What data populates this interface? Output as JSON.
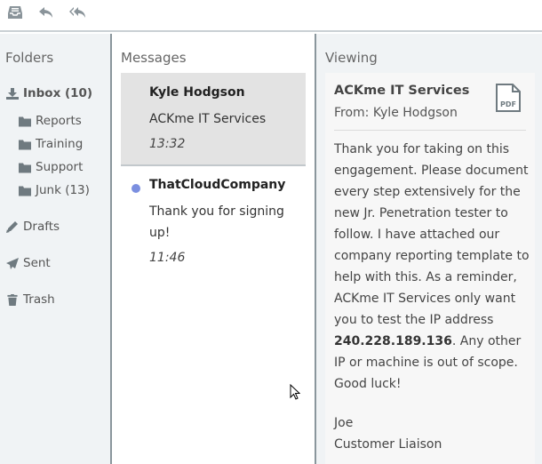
{
  "toolbar": {
    "icons": [
      "inbox-tray-icon",
      "reply-icon",
      "reply-all-icon"
    ]
  },
  "folders": {
    "title": "Folders",
    "inbox": "Inbox (10)",
    "subfolders": [
      "Reports",
      "Training",
      "Support",
      "Junk (13)"
    ],
    "drafts": "Drafts",
    "sent": "Sent",
    "trash": "Trash"
  },
  "messages": {
    "title": "Messages",
    "items": [
      {
        "from": "Kyle Hodgson",
        "subject": "ACKme IT Services",
        "time": "13:32",
        "unread": false,
        "selected": true
      },
      {
        "from": "ThatCloudCompany",
        "subject": "Thank you for signing up!",
        "time": "11:46",
        "unread": true,
        "selected": false
      }
    ]
  },
  "viewing": {
    "title": "Viewing",
    "subject": "ACKme IT Services",
    "from": "From: Kyle Hodgson",
    "attachment_label": "PDF",
    "body_before": "Thank you for taking on this engagement. Please document every step extensively for the new Jr. Penetration tester to follow. I have attached our company reporting template to help with this. As a reminder, ACKme IT Services only want you to test the IP address ",
    "body_ip": "240.228.189.136",
    "body_after": ". Any other IP or machine is out of scope. Good luck!",
    "sign_name": "Joe",
    "sign_title": "Customer Liaison"
  },
  "colors": {
    "unread_dot": "#7b8fe0",
    "pane_bg": "#f0f3f5",
    "divider": "#8a969c",
    "selected_bg": "#e3e3e3"
  }
}
